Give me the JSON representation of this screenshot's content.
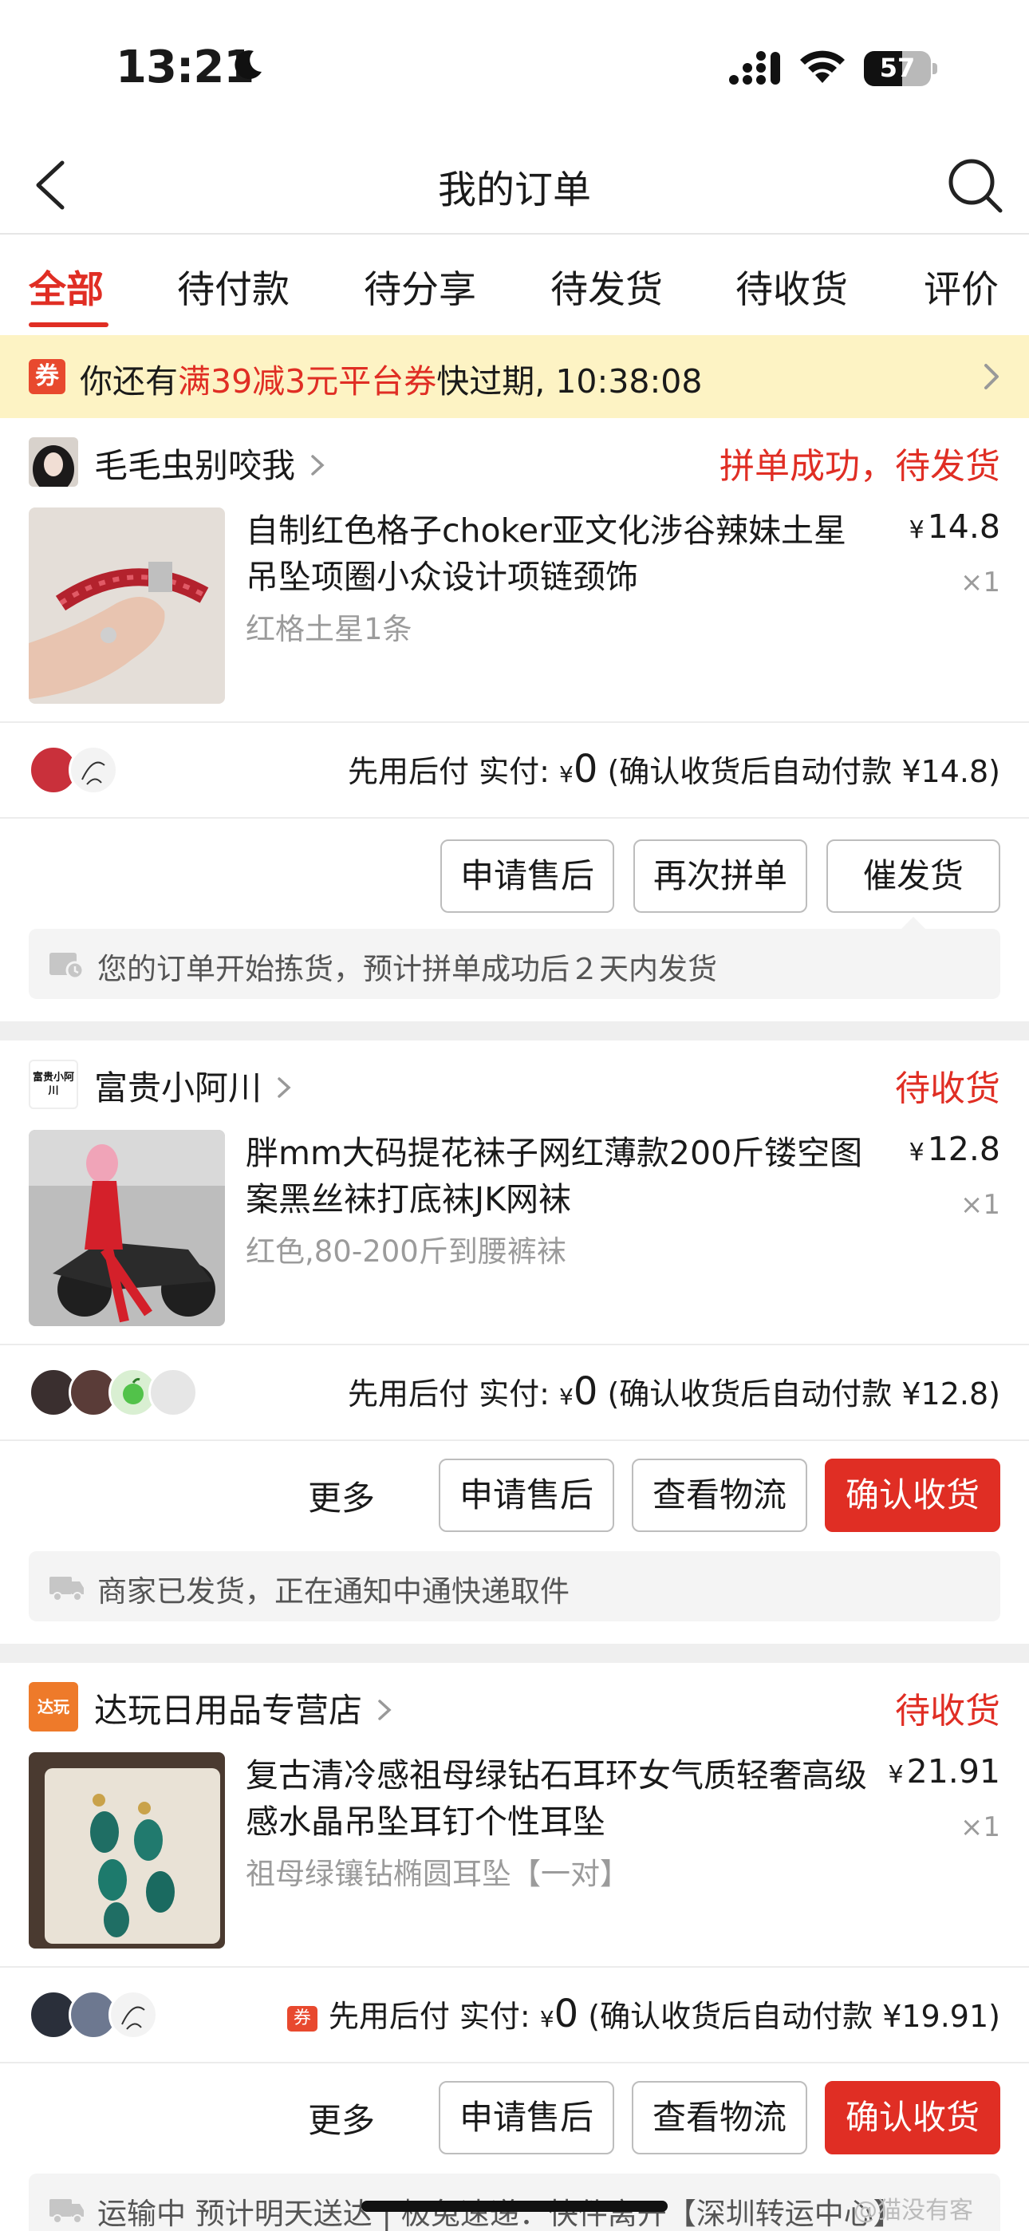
{
  "status_bar": {
    "time": "13:21",
    "battery": "57",
    "battery_level_percent": 57
  },
  "nav": {
    "title": "我的订单"
  },
  "tabs": [
    {
      "label": "全部",
      "active": true
    },
    {
      "label": "待付款",
      "active": false
    },
    {
      "label": "待分享",
      "active": false
    },
    {
      "label": "待发货",
      "active": false
    },
    {
      "label": "待收货",
      "active": false
    },
    {
      "label": "评价",
      "active": false
    }
  ],
  "banner": {
    "prefix": "你还有",
    "coupon": "满39减3元平台券",
    "suffix": "快过期, 10:38:08",
    "icon_char": "券"
  },
  "orders": [
    {
      "shop_name": "毛毛虫别咬我",
      "status": "拼单成功，待发货",
      "product_title": "自制红色格子choker亚文化涉谷辣妹土星吊坠项圈小众设计项链颈饰",
      "product_spec": "红格土星1条",
      "price": "14.8",
      "qty": "×1",
      "pay_prefix": "先用后付 实付:",
      "pay_yen": "¥",
      "pay_zero": "0",
      "pay_suffix": "(确认收货后自动付款 ¥14.8)",
      "buttons": [
        "申请售后",
        "再次拼单",
        "催发货"
      ],
      "tip": "您的订单开始拣货，预计拼单成功后２天内发货"
    },
    {
      "shop_name": "富贵小阿川",
      "shop_logo_text": "富贵小阿川",
      "status": "待收货",
      "product_title": "胖mm大码提花袜子网红薄款200斤镂空图案黑丝袜打底袜JK网袜",
      "product_spec": "红色,80-200斤到腰裤袜",
      "price": "12.8",
      "qty": "×1",
      "pay_prefix": "先用后付 实付:",
      "pay_yen": "¥",
      "pay_zero": "0",
      "pay_suffix": "(确认收货后自动付款 ¥12.8)",
      "more": "更多",
      "buttons": [
        "申请售后",
        "查看物流",
        "确认收货"
      ],
      "tip": "商家已发货，正在通知中通快递取件"
    },
    {
      "shop_name": "达玩日用品专营店",
      "shop_logo_text": "达玩",
      "status": "待收货",
      "product_title": "复古清冷感祖母绿钻石耳环女气质轻奢高级感水晶吊坠耳钉个性耳坠",
      "product_spec": "祖母绿镶钻椭圆耳坠【一对】",
      "price": "21.91",
      "qty": "×1",
      "coupon_tag": "券",
      "pay_prefix": "先用后付 实付:",
      "pay_yen": "¥",
      "pay_zero": "0",
      "pay_suffix": "(确认收货后自动付款 ¥19.91)",
      "more": "更多",
      "buttons": [
        "申请售后",
        "查看物流",
        "确认收货"
      ],
      "tip": "运输中 预计明天送达 | 极兔速递：快件离开【深圳转运中心】"
    }
  ],
  "watermark": "@猫没有客",
  "colors": {
    "accent": "#e02e24",
    "banner_bg": "#fdf3c4",
    "divider": "#efefef"
  }
}
